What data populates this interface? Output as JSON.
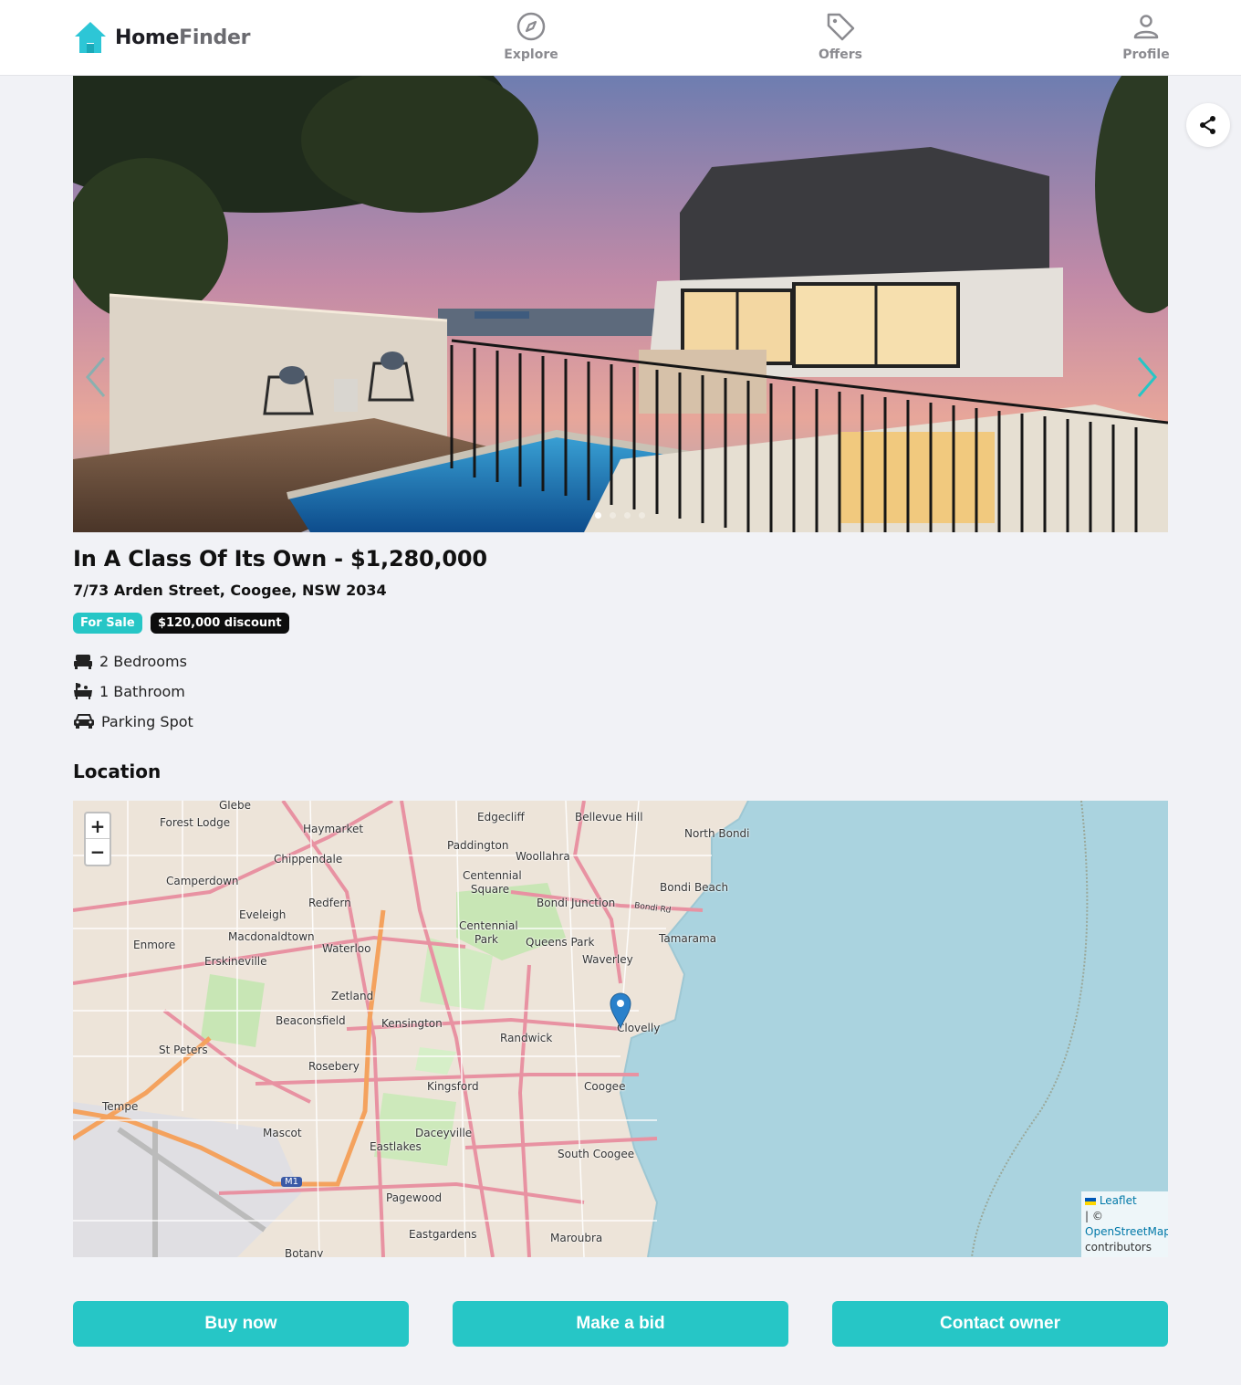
{
  "header": {
    "logo_home": "Home",
    "logo_finder": "Finder",
    "nav": [
      {
        "label": "Explore",
        "icon": "compass-icon"
      },
      {
        "label": "Offers",
        "icon": "tag-icon"
      },
      {
        "label": "Profile",
        "icon": "user-icon"
      }
    ]
  },
  "gallery": {
    "slide_count": 4,
    "active_slide": 1
  },
  "listing": {
    "title": "In A Class Of Its Own - $1,280,000",
    "address": "7/73 Arden Street, Coogee, NSW 2034",
    "badges": {
      "status": "For Sale",
      "discount": "$120,000 discount"
    },
    "features": [
      {
        "icon": "bed-icon",
        "label": "2 Bedrooms"
      },
      {
        "icon": "bath-icon",
        "label": "1 Bathroom"
      },
      {
        "icon": "car-icon",
        "label": "Parking Spot"
      }
    ]
  },
  "location": {
    "heading": "Location",
    "zoom_in": "+",
    "zoom_out": "−",
    "attribution": {
      "leaflet": "Leaflet",
      "sep": "| ©",
      "osm": "OpenStreetMap",
      "contributors": "contributors"
    },
    "place_labels": [
      "Glebe",
      "Forest Lodge",
      "Haymarket",
      "Edgecliff",
      "Bellevue Hill",
      "North Bondi",
      "Paddington",
      "Woollahra",
      "Chippendale",
      "Camperdown",
      "Centennial Square",
      "Bondi Beach",
      "Bondi Junction",
      "Redfern",
      "Eveleigh",
      "Macdonaldtown",
      "Enmore",
      "Erskineville",
      "Waterloo",
      "Centennial Park",
      "Queens Park",
      "Tamarama",
      "Waverley",
      "Zetland",
      "Beaconsfield",
      "Kensington",
      "Randwick",
      "Clovelly",
      "St Peters",
      "Rosebery",
      "Kingsford",
      "Coogee",
      "Tempe",
      "Mascot",
      "Eastlakes",
      "Daceyville",
      "South Coogee",
      "Pagewood",
      "Eastgardens",
      "Maroubra",
      "Botany",
      "M1",
      "Bondi Rd"
    ]
  },
  "actions": {
    "buy": "Buy now",
    "bid": "Make a bid",
    "contact": "Contact owner"
  },
  "colors": {
    "accent": "#26c6c6",
    "dark": "#0d0d0d"
  }
}
